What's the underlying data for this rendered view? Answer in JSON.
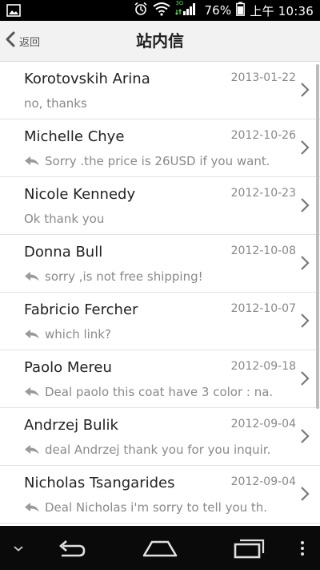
{
  "status_bar": {
    "battery": "76%",
    "time": "上午 10:36",
    "network_badge": "3G",
    "icons": [
      "image-icon",
      "alarm-icon",
      "wifi-icon",
      "signal-icon",
      "battery-icon"
    ]
  },
  "header": {
    "back_label": "返回",
    "title": "站内信"
  },
  "messages": [
    {
      "name": "Korotovskih Arina",
      "date": "2013-01-22",
      "text": "no, thanks",
      "replied": false
    },
    {
      "name": "Michelle Chye",
      "date": "2012-10-26",
      "text": "Sorry .the price is 26USD if you want.",
      "replied": true
    },
    {
      "name": "Nicole Kennedy",
      "date": "2012-10-23",
      "text": "Ok thank you",
      "replied": false
    },
    {
      "name": "Donna Bull",
      "date": "2012-10-08",
      "text": "sorry ,is not free shipping!",
      "replied": true
    },
    {
      "name": "Fabricio Fercher",
      "date": "2012-10-07",
      "text": "which link?",
      "replied": true
    },
    {
      "name": "Paolo Mereu",
      "date": "2012-09-18",
      "text": "Deal paolo this coat have 3 color : na.",
      "replied": true
    },
    {
      "name": "Andrzej Bulik",
      "date": "2012-09-04",
      "text": "deal Andrzej thank you for you inquir.",
      "replied": true
    },
    {
      "name": "Nicholas Tsangarides",
      "date": "2012-09-04",
      "text": "Deal Nicholas i'm sorry to tell you th.",
      "replied": true
    }
  ],
  "nav_bar": {
    "icons": [
      "chevron-down-icon",
      "back-nav-icon",
      "home-icon",
      "recent-apps-icon",
      "menu-dots-icon"
    ]
  }
}
